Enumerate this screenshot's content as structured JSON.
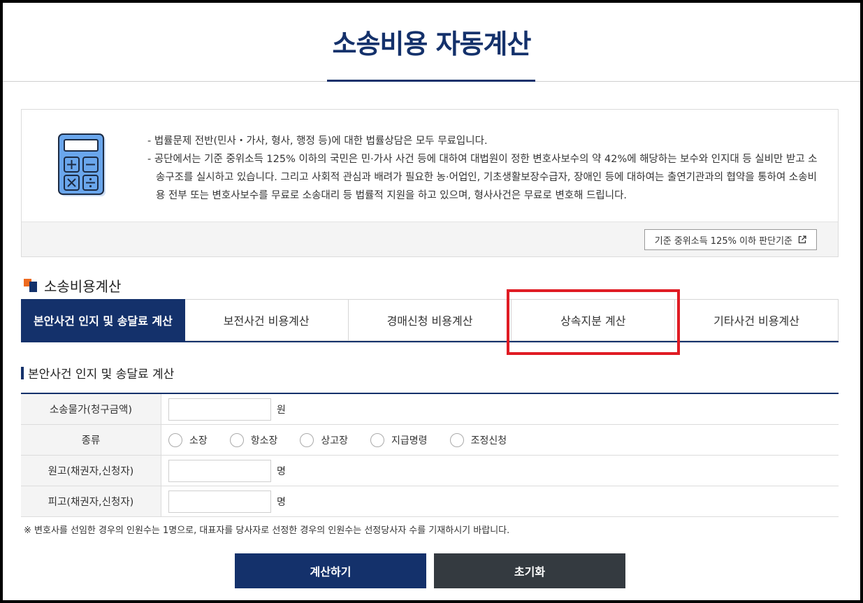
{
  "page": {
    "title": "소송비용 자동계산"
  },
  "info": {
    "lines": [
      "- 법률문제 전반(민사・가사, 형사, 행정 등)에 대한 법률상담은 모두 무료입니다.",
      "- 공단에서는 기준 중위소득 125% 이하의 국민은 민·가사 사건 등에 대하여 대법원이 정한 변호사보수의 약 42%에 해당하는 보수와 인지대 등 실비만 받고 소송구조를 실시하고 있습니다. 그리고 사회적 관심과 배려가 필요한 농·어업인, 기초생활보장수급자, 장애인 등에 대하여는 출연기관과의 협약을 통하여 소송비용 전부 또는 변호사보수를 무료로 소송대리 등 법률적 지원을 하고 있으며, 형사사건은 무료로 변호해 드립니다."
    ],
    "criteria_button": "기준 중위소득 125% 이하 판단기준",
    "criteria_icon": "external-link-icon",
    "illustration_icon": "calculator-icon"
  },
  "section": {
    "title": "소송비용계산"
  },
  "tabs": [
    {
      "label": "본안사건 인지 및 송달료 계산",
      "active": true
    },
    {
      "label": "보전사건 비용계산",
      "active": false
    },
    {
      "label": "경매신청 비용계산",
      "active": false
    },
    {
      "label": "상속지분 계산",
      "active": false
    },
    {
      "label": "기타사건 비용계산",
      "active": false
    }
  ],
  "form": {
    "subtitle": "본안사건 인지 및 송달료 계산",
    "claim_label": "소송물가(청구금액)",
    "claim_unit": "원",
    "type_label": "종류",
    "type_options": [
      "소장",
      "항소장",
      "상고장",
      "지급명령",
      "조정신청"
    ],
    "plaintiff_label": "원고(채권자,신청자)",
    "plaintiff_unit": "명",
    "defendant_label": "피고(채권자,신청자)",
    "defendant_unit": "명",
    "claim_value": "",
    "plaintiff_value": "",
    "defendant_value": ""
  },
  "note": "※ 변호사를 선임한 경우의 인원수는 1명으로, 대표자를 당사자로 선정한 경우의 인원수는 선정당사자 수를 기재하시기 바랍니다.",
  "buttons": {
    "calculate": "계산하기",
    "reset": "초기화"
  },
  "colors": {
    "primary": "#14316b",
    "accent": "#ee6a1f",
    "reset": "#343a40",
    "highlight": "#e01c24"
  }
}
